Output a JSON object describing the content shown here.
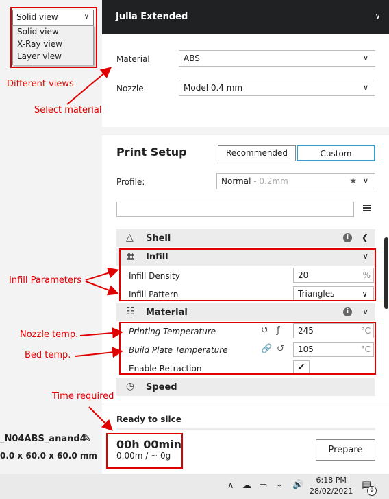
{
  "view_menu": {
    "selected": "Solid view",
    "options": [
      "Solid view",
      "X-Ray view",
      "Layer view"
    ]
  },
  "printer": {
    "name": "Julia Extended"
  },
  "material": {
    "label": "Material",
    "value": "ABS"
  },
  "nozzle": {
    "label": "Nozzle",
    "value": "Model 0.4 mm"
  },
  "print_setup": {
    "title": "Print Setup",
    "tabs": [
      "Recommended",
      "Custom"
    ],
    "profile_label": "Profile:",
    "profile_value": "Normal",
    "profile_detail": " - 0.2mm"
  },
  "categories": {
    "shell": "Shell",
    "infill": "Infill",
    "material": "Material",
    "speed": "Speed"
  },
  "settings": {
    "infill_density": {
      "label": "Infill Density",
      "value": "20",
      "unit": "%"
    },
    "infill_pattern": {
      "label": "Infill Pattern",
      "value": "Triangles"
    },
    "printing_temp": {
      "label": "Printing Temperature",
      "value": "245",
      "unit": "°C"
    },
    "bed_temp": {
      "label": "Build Plate Temperature",
      "value": "105",
      "unit": "°C"
    },
    "retraction": {
      "label": "Enable Retraction",
      "checked": true
    }
  },
  "slice": {
    "status": "Ready to slice",
    "time": "00h 00min",
    "material_amount": "0.00m / ~ 0g",
    "prepare_label": "Prepare"
  },
  "job": {
    "name": "_N04ABS_anand4",
    "dimensions": "0.0 x 60.0 x 60.0 mm"
  },
  "annotations": {
    "different_views": "Different views",
    "select_material": "Select material",
    "infill_parameters": "Infill Parameters",
    "nozzle_temp": "Nozzle temp.",
    "bed_temp": "Bed temp.",
    "time_required": "Time required"
  },
  "taskbar": {
    "time": "6:18 PM",
    "date": "28/02/2021",
    "notifications": "9"
  },
  "colors": {
    "annotation": "#e00000",
    "accent": "#3b9cc7",
    "header": "#1f2123"
  }
}
